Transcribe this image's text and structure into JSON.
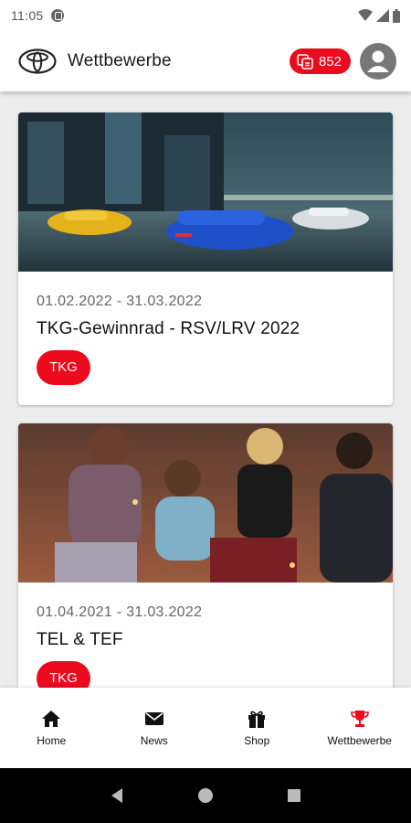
{
  "status_bar": {
    "time": "11:05"
  },
  "app_bar": {
    "title": "Wettbewerbe",
    "points": "852"
  },
  "cards": [
    {
      "date": "01.02.2022 - 31.03.2022",
      "title": "TKG-Gewinnrad - RSV/LRV 2022",
      "tag": "TKG"
    },
    {
      "date": "01.04.2021 - 31.03.2022",
      "title": "TEL & TEF",
      "tag": "TKG"
    }
  ],
  "bottom_nav": [
    {
      "label": "Home",
      "icon": "home-icon"
    },
    {
      "label": "News",
      "icon": "mail-icon"
    },
    {
      "label": "Shop",
      "icon": "gift-icon"
    },
    {
      "label": "Wettbewerbe",
      "icon": "trophy-icon",
      "active": true
    }
  ],
  "colors": {
    "accent": "#eb0a1e",
    "active_icon": "#eb0a1e"
  }
}
